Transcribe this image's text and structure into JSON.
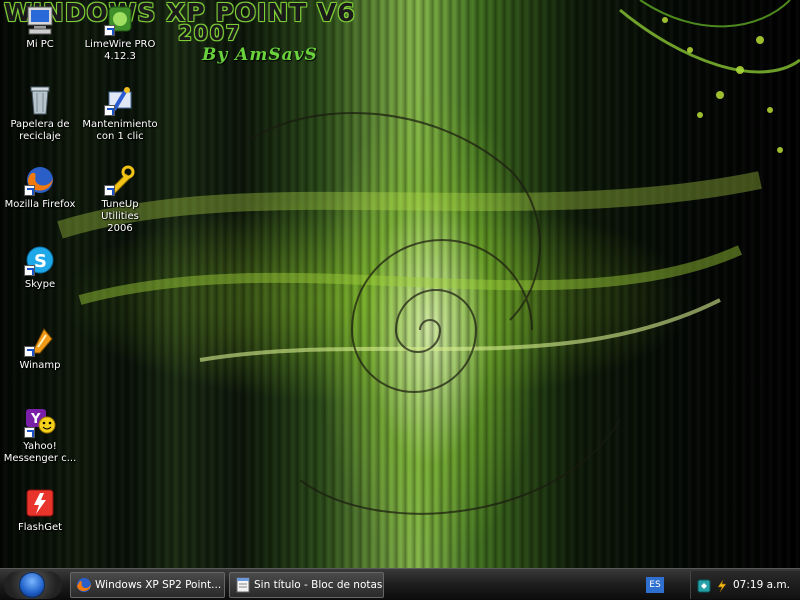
{
  "wallpaper": {
    "title": "WINDOWS XP POINT V6",
    "year": "2007",
    "author": "By AmSavS",
    "accent": "#86c43a"
  },
  "desktop": {
    "icons": [
      {
        "label": "Mi PC",
        "icon": "computer-icon"
      },
      {
        "label": "LimeWire PRO\n4.12.3",
        "icon": "limewire-icon"
      },
      {
        "label": "Papelera de\nreciclaje",
        "icon": "recycle-bin-icon"
      },
      {
        "label": "Mantenimiento\ncon 1 clic",
        "icon": "maintenance-icon"
      },
      {
        "label": "Mozilla Firefox",
        "icon": "firefox-icon"
      },
      {
        "label": "TuneUp Utilities\n2006",
        "icon": "tuneup-icon"
      },
      {
        "label": "Skype",
        "icon": "skype-icon"
      },
      {
        "label": "Winamp",
        "icon": "winamp-icon"
      },
      {
        "label": "Yahoo!\nMessenger c...",
        "icon": "yahoo-messenger-icon"
      },
      {
        "label": "FlashGet",
        "icon": "flashget-icon"
      }
    ]
  },
  "taskbar": {
    "start_icon": "windows-orb-icon",
    "tasks": [
      {
        "label": "Windows XP SP2 Point...",
        "icon": "firefox-icon"
      },
      {
        "label": "Sin título - Bloc de notas",
        "icon": "notepad-icon"
      }
    ],
    "language": "ES",
    "clock": "07:19 a.m."
  }
}
